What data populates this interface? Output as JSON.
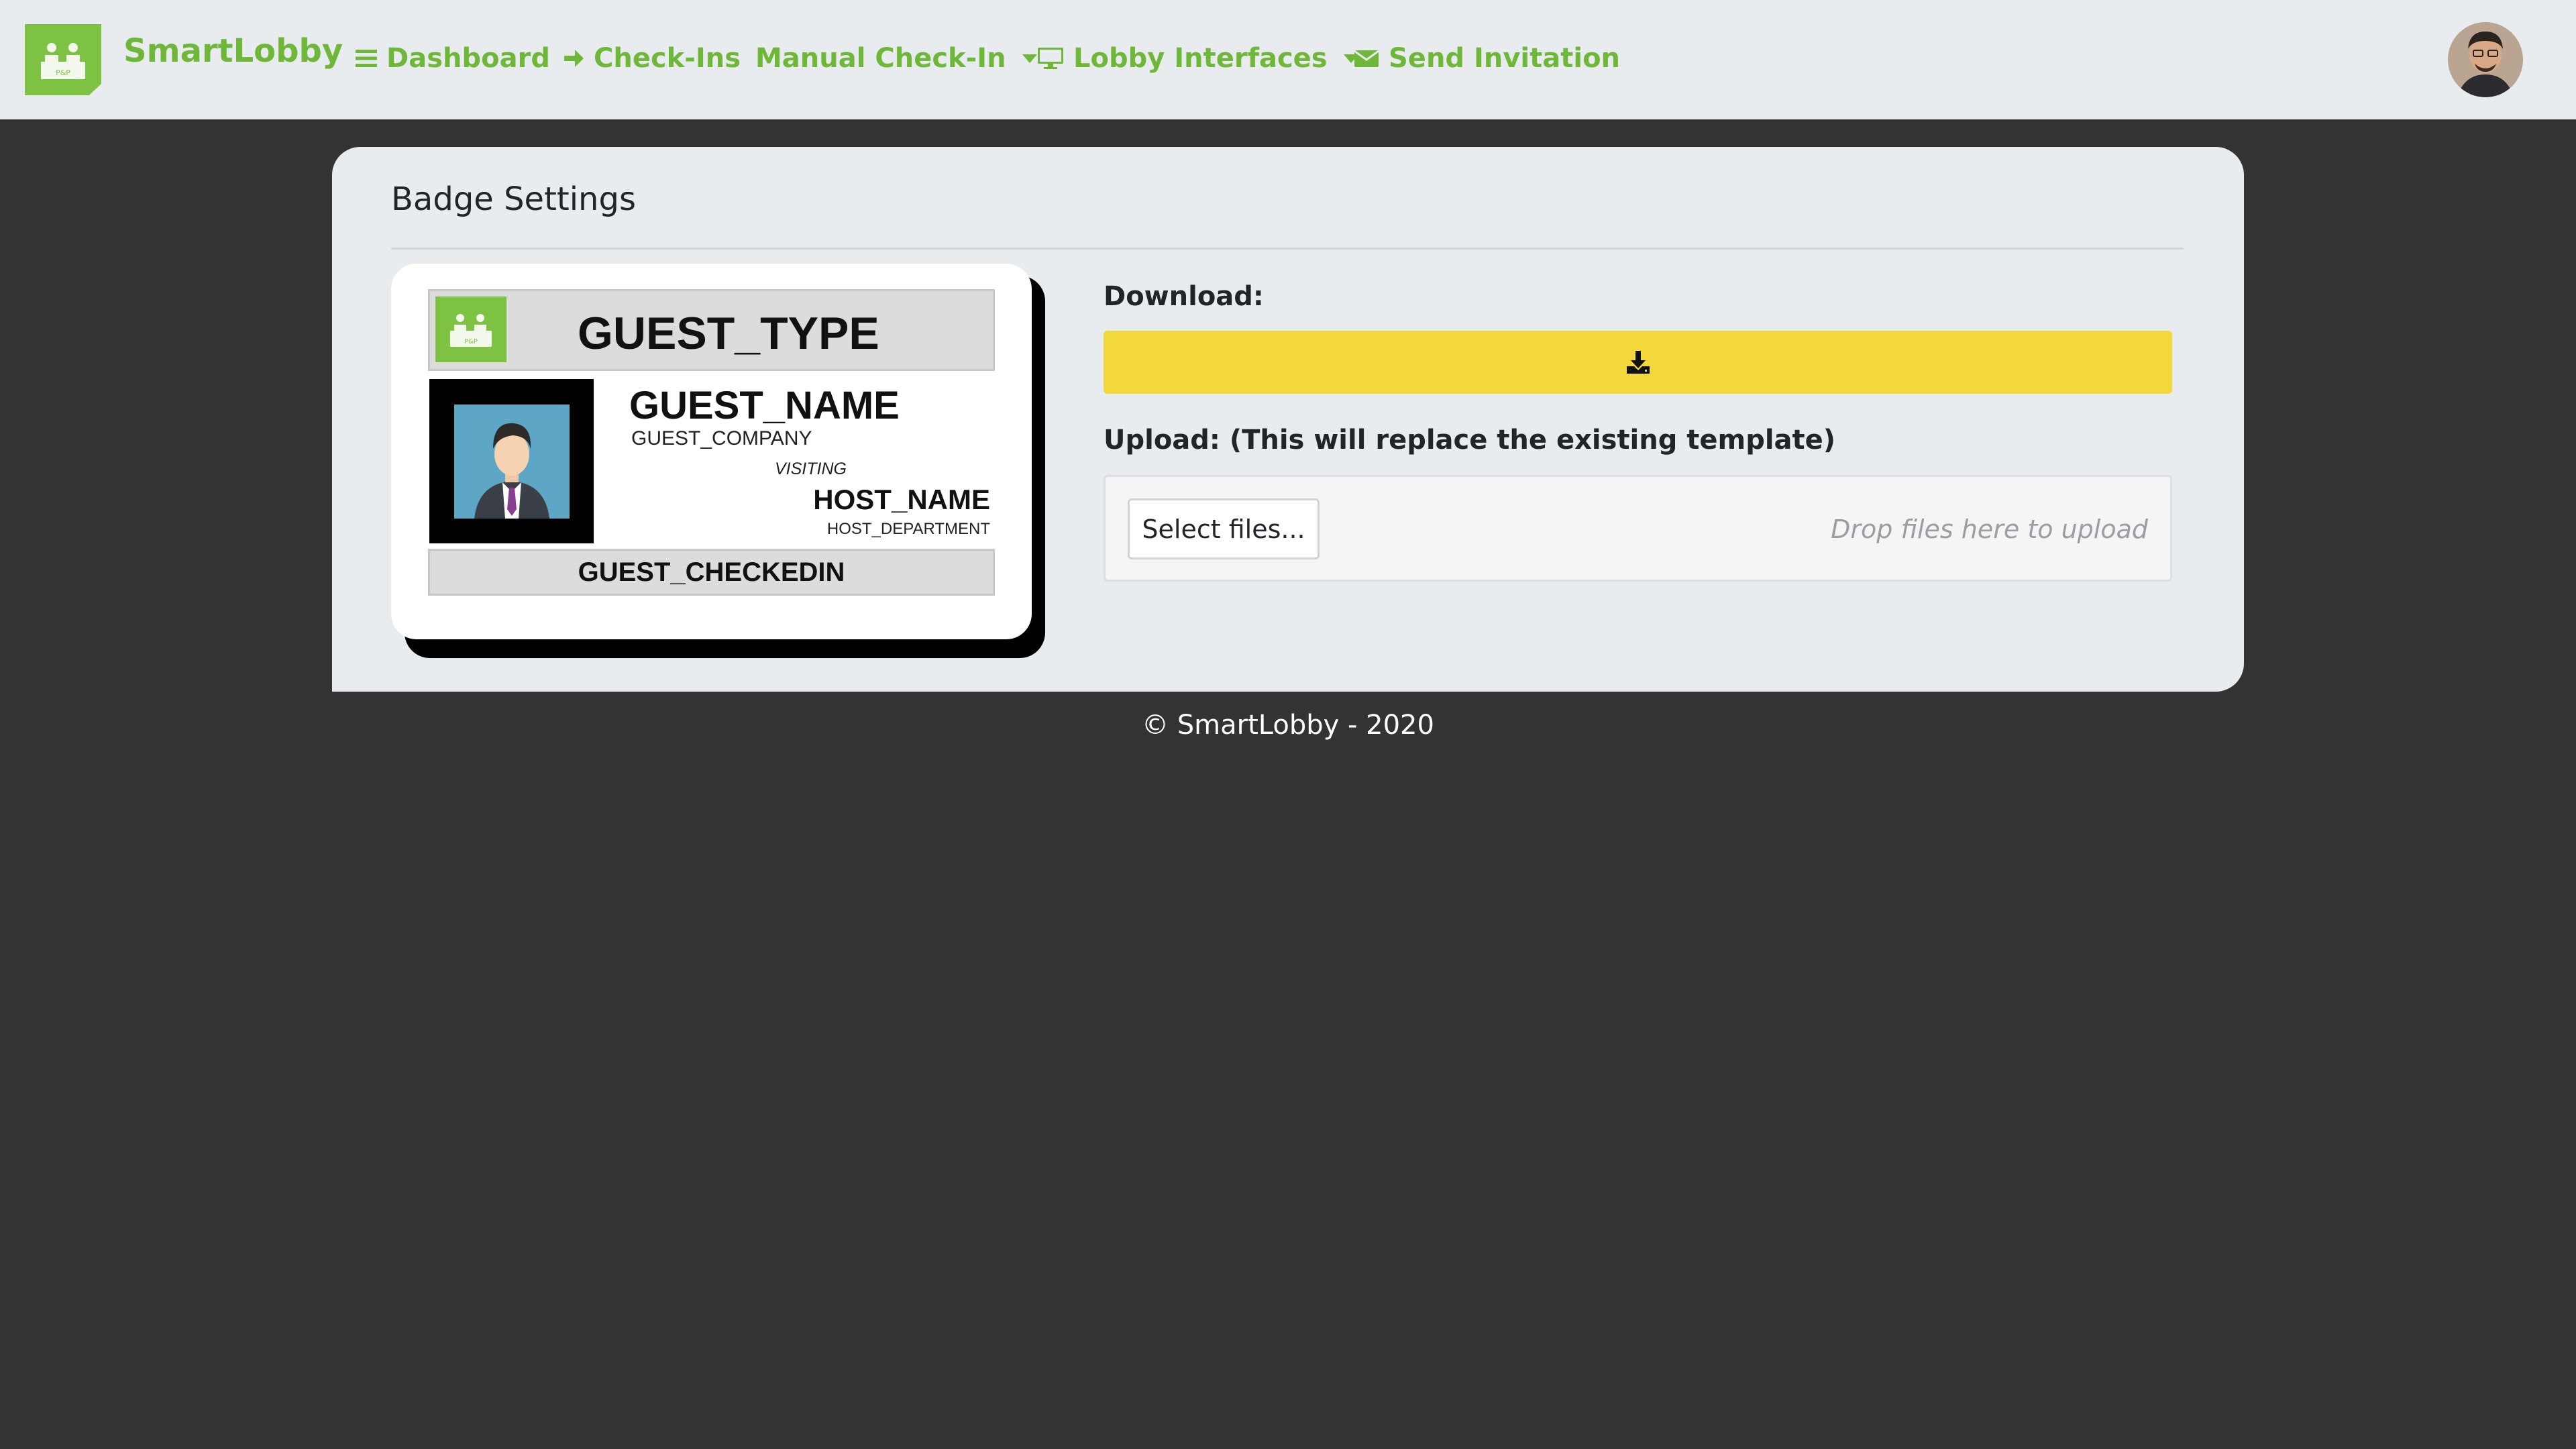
{
  "brand": {
    "name": "SmartLobby",
    "logo_caption": "P&P"
  },
  "nav": {
    "items": [
      {
        "label": "Dashboard",
        "icon": "bars-icon"
      },
      {
        "label": "Check-Ins",
        "icon": "arrow-right-icon"
      },
      {
        "label": "Manual Check-In",
        "icon": "",
        "dropdown": true
      },
      {
        "label": "Lobby Interfaces",
        "icon": "desktop-icon",
        "dropdown": true
      },
      {
        "label": "Send Invitation",
        "icon": "envelope-icon"
      }
    ]
  },
  "page": {
    "title": "Badge Settings"
  },
  "badge": {
    "guest_type": "GUEST_TYPE",
    "guest_name": "GUEST_NAME",
    "guest_company": "GUEST_COMPANY",
    "visiting": "VISITING",
    "host_name": "HOST_NAME",
    "host_department": "HOST_DEPARTMENT",
    "checkin": "GUEST_CHECKEDIN"
  },
  "download": {
    "label": "Download:",
    "icon": "download-icon"
  },
  "upload": {
    "label": "Upload: (This will replace the existing template)",
    "select_button": "Select files...",
    "drop_hint": "Drop files here to upload"
  },
  "footer": {
    "text": "© SmartLobby - 2020"
  },
  "colors": {
    "brand_green": "#6fb739",
    "download_yellow": "#f2d83a",
    "background": "#333333",
    "card": "#e9ecef"
  }
}
